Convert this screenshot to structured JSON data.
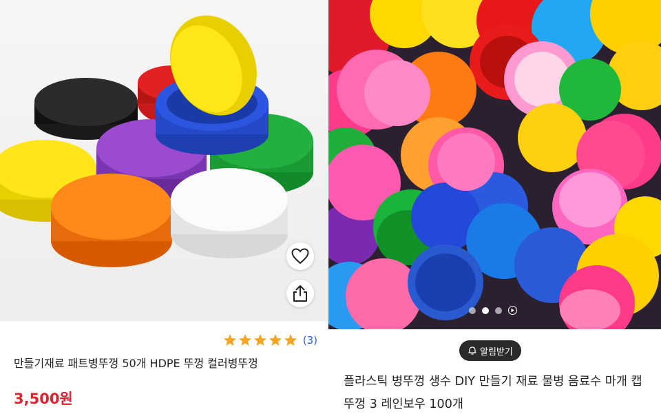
{
  "left_product": {
    "image_icon": "bottle-caps-photo",
    "wishlist_icon": "heart-icon",
    "share_icon": "share-icon",
    "rating": {
      "stars": 5,
      "count_text": "(3)",
      "star_color": "#f5a623"
    },
    "title": "만들기재료 패트병뚜껑 50개 HDPE 뚜껑 컬러병뚜껑",
    "price": "3,500원",
    "price_color": "#e0222f"
  },
  "right_product": {
    "image_icon": "colorful-caps-photo",
    "carousel": {
      "total": 3,
      "active": 1,
      "has_video": true
    },
    "notify_label": "알림받기",
    "notify_icon": "bell-plus-icon",
    "title": "플라스틱 병뚜껑 생수 DIY 만들기 재료 물병 음료수 마개 캡 뚜껑 3 레인보우 100개"
  }
}
